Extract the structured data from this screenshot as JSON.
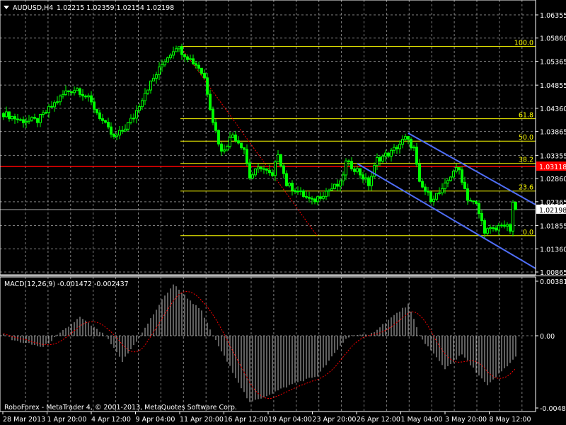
{
  "header": {
    "symbol": "AUDUSD,H4",
    "ohlc": "1.02215 1.02359 1.02154 1.02198"
  },
  "macd_label": "MACD(12,26,9) -0.001472 -0.002437",
  "copyright": "RoboForex - MetaTrader 4, © 2001-2013, MetaQuotes Software Corp.",
  "colors": {
    "bull": "#00ff00",
    "grid": "#7f7f7f",
    "fib": "#ffff00",
    "channel": "#4f6ef7",
    "support": "#ff0000",
    "macd_hist": "#c0c0c0",
    "signal": "#ff0000"
  },
  "chart_data": [
    {
      "type": "candlestick",
      "title": "AUDUSD,H4",
      "ylim": [
        1.00865,
        1.06355
      ],
      "price_ticks": [
        "1.06355",
        "1.05860",
        "1.05365",
        "1.04855",
        "1.04360",
        "1.03865",
        "1.03355",
        "1.02860",
        "1.02365",
        "1.01855",
        "1.01360",
        "1.00865"
      ],
      "x_ticks": [
        "28 Mar 2013",
        "1 Apr 20:00",
        "4 Apr 12:00",
        "9 Apr 04:00",
        "11 Apr 20:00",
        "16 Apr 12:00",
        "19 Apr 04:00",
        "23 Apr 20:00",
        "26 Apr 12:00",
        "1 May 04:00",
        "3 May 20:00",
        "8 May 12:00"
      ],
      "bar_count": 182,
      "close_anchors": [
        [
          0,
          1.0425
        ],
        [
          6,
          1.041
        ],
        [
          12,
          1.041
        ],
        [
          17,
          1.044
        ],
        [
          22,
          1.0471
        ],
        [
          26,
          1.0478
        ],
        [
          30,
          1.0456
        ],
        [
          34,
          1.0418
        ],
        [
          39,
          1.0372
        ],
        [
          42,
          1.0388
        ],
        [
          46,
          1.0418
        ],
        [
          50,
          1.0471
        ],
        [
          54,
          1.0509
        ],
        [
          57,
          1.0539
        ],
        [
          61,
          1.0569
        ],
        [
          65,
          1.0546
        ],
        [
          69,
          1.0524
        ],
        [
          71,
          1.0501
        ],
        [
          74,
          1.041
        ],
        [
          77,
          1.0342
        ],
        [
          81,
          1.038
        ],
        [
          85,
          1.035
        ],
        [
          87,
          1.0289
        ],
        [
          91,
          1.0312
        ],
        [
          95,
          1.0289
        ],
        [
          97,
          1.0342
        ],
        [
          100,
          1.0274
        ],
        [
          104,
          1.0259
        ],
        [
          109,
          1.0236
        ],
        [
          114,
          1.0259
        ],
        [
          119,
          1.0274
        ],
        [
          121,
          1.032
        ],
        [
          125,
          1.0304
        ],
        [
          129,
          1.0274
        ],
        [
          132,
          1.0327
        ],
        [
          137,
          1.0342
        ],
        [
          142,
          1.0372
        ],
        [
          145,
          1.035
        ],
        [
          147,
          1.0274
        ],
        [
          151,
          1.0244
        ],
        [
          155,
          1.0259
        ],
        [
          159,
          1.0304
        ],
        [
          161,
          1.0304
        ],
        [
          164,
          1.0244
        ],
        [
          167,
          1.0229
        ],
        [
          170,
          1.0176
        ],
        [
          174,
          1.0176
        ],
        [
          176,
          1.0191
        ],
        [
          179,
          1.0176
        ],
        [
          180,
          1.0229
        ],
        [
          181,
          1.022
        ]
      ],
      "last_price": "1.02198",
      "horizontal_line": {
        "price": 1.03118,
        "label": "1.03118"
      },
      "fibonacci": {
        "high": 1.0568,
        "low": 1.0164,
        "levels": [
          {
            "pct": 100,
            "label": "100.0"
          },
          {
            "pct": 61.8,
            "label": "61.8"
          },
          {
            "pct": 50,
            "label": "50.0"
          },
          {
            "pct": 38.2,
            "label": "38.2"
          },
          {
            "pct": 23.6,
            "label": "23.6"
          },
          {
            "pct": 0,
            "label": "0.0"
          }
        ]
      },
      "channel": {
        "upper": [
          [
            143,
            1.0383
          ],
          [
            181,
            1.0254
          ]
        ],
        "lower": [
          [
            125,
            1.0318
          ],
          [
            181,
            1.0119
          ]
        ]
      }
    },
    {
      "type": "histogram+line",
      "title": "MACD(12,26,9)",
      "ylim": [
        -0.004841,
        0.003812
      ],
      "y_ticks": [
        "0.003812",
        "0.00",
        "-0.004841"
      ],
      "main_anchors": [
        [
          0,
          0.0002
        ],
        [
          3,
          -0.0003
        ],
        [
          14,
          -0.0008
        ],
        [
          27,
          0.0013
        ],
        [
          36,
          0.0
        ],
        [
          42,
          -0.0018
        ],
        [
          49,
          0.0002
        ],
        [
          56,
          0.0025
        ],
        [
          60,
          0.0036
        ],
        [
          70,
          0.0017
        ],
        [
          74,
          0.0
        ],
        [
          87,
          -0.0047
        ],
        [
          103,
          -0.0033
        ],
        [
          111,
          -0.0028
        ],
        [
          121,
          -0.0002
        ],
        [
          124,
          0.0001
        ],
        [
          129,
          0.0
        ],
        [
          143,
          0.0022
        ],
        [
          147,
          0.0
        ],
        [
          156,
          -0.0023
        ],
        [
          162,
          -0.0013
        ],
        [
          171,
          -0.0035
        ],
        [
          181,
          -0.0015
        ]
      ],
      "signal_period": 9
    }
  ]
}
